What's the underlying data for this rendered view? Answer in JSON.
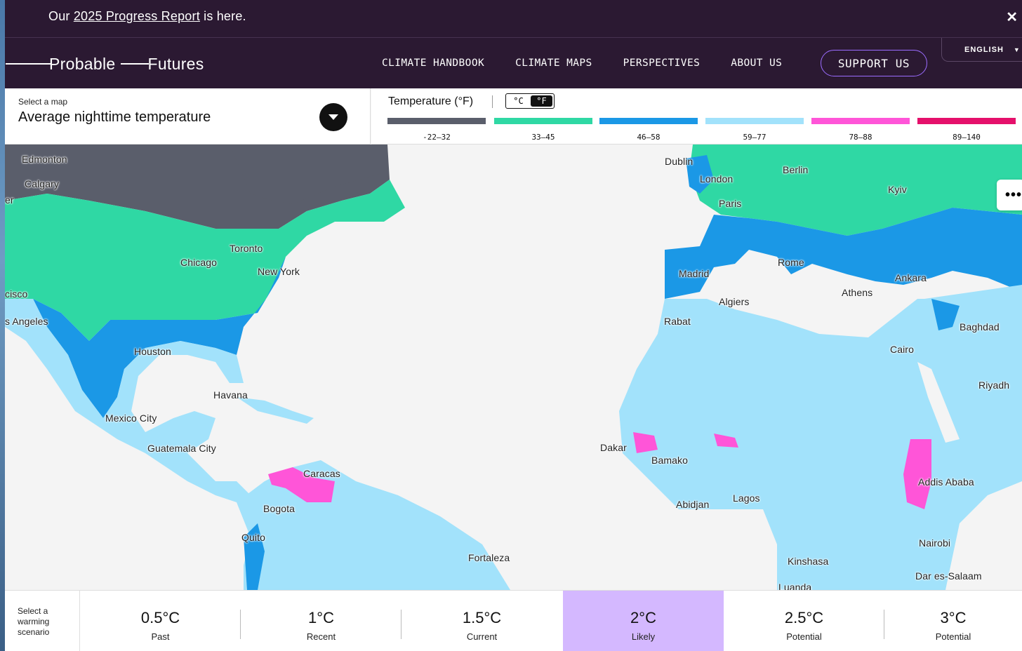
{
  "announcement": {
    "prefix": "Our ",
    "link": "2025 Progress Report",
    "suffix": " is here.",
    "close_icon": "close-icon"
  },
  "nav": {
    "logo_word1": "Probable",
    "logo_word2": "Futures",
    "links": [
      "CLIMATE HANDBOOK",
      "CLIMATE MAPS",
      "PERSPECTIVES",
      "ABOUT US"
    ],
    "support": "SUPPORT US",
    "language": "ENGLISH"
  },
  "map_select": {
    "label": "Select a map",
    "value": "Average nighttime temperature"
  },
  "legend": {
    "title": "Temperature (°F)",
    "unit_c": "°C",
    "unit_f": "°F",
    "active_unit": "°F",
    "bins": [
      {
        "label": "-22–32",
        "color": "#5a5e6b"
      },
      {
        "label": "33–45",
        "color": "#2fd8a4"
      },
      {
        "label": "46–58",
        "color": "#1b98e6"
      },
      {
        "label": "59–77",
        "color": "#a2e2fb"
      },
      {
        "label": "78–88",
        "color": "#ff55d8"
      },
      {
        "label": "89–140",
        "color": "#e5106b"
      }
    ]
  },
  "cities": {
    "edmonton": "Edmonton",
    "calgary": "Calgary",
    "francisco": "cisco",
    "angeles": "s Angeles",
    "er": "er",
    "chicago": "Chicago",
    "toronto": "Toronto",
    "newyork": "New York",
    "houston": "Houston",
    "havana": "Havana",
    "mexico": "Mexico City",
    "guatemala": "Guatemala City",
    "caracas": "Caracas",
    "bogota": "Bogota",
    "quito": "Quito",
    "fortaleza": "Fortaleza",
    "dublin": "Dublin",
    "london": "London",
    "paris": "Paris",
    "berlin": "Berlin",
    "kyiv": "Kyiv",
    "madrid": "Madrid",
    "rome": "Rome",
    "athens": "Athens",
    "ankara": "Ankara",
    "algiers": "Algiers",
    "rabat": "Rabat",
    "baghdad": "Baghdad",
    "cairo": "Cairo",
    "riyadh": "Riyadh",
    "dakar": "Dakar",
    "bamako": "Bamako",
    "abidjan": "Abidjan",
    "lagos": "Lagos",
    "addis": "Addis Ababa",
    "kinshasa": "Kinshasa",
    "nairobi": "Nairobi",
    "dar": "Dar es-Salaam",
    "luanda": "Luanda"
  },
  "scenario": {
    "label": "Select a warming scenario",
    "active_index": 3,
    "options": [
      {
        "degree": "0.5°C",
        "sub": "Past"
      },
      {
        "degree": "1°C",
        "sub": "Recent"
      },
      {
        "degree": "1.5°C",
        "sub": "Current"
      },
      {
        "degree": "2°C",
        "sub": "Likely"
      },
      {
        "degree": "2.5°C",
        "sub": "Potential"
      },
      {
        "degree": "3°C",
        "sub": "Potential"
      }
    ]
  },
  "more_icon": "more-dots-icon"
}
